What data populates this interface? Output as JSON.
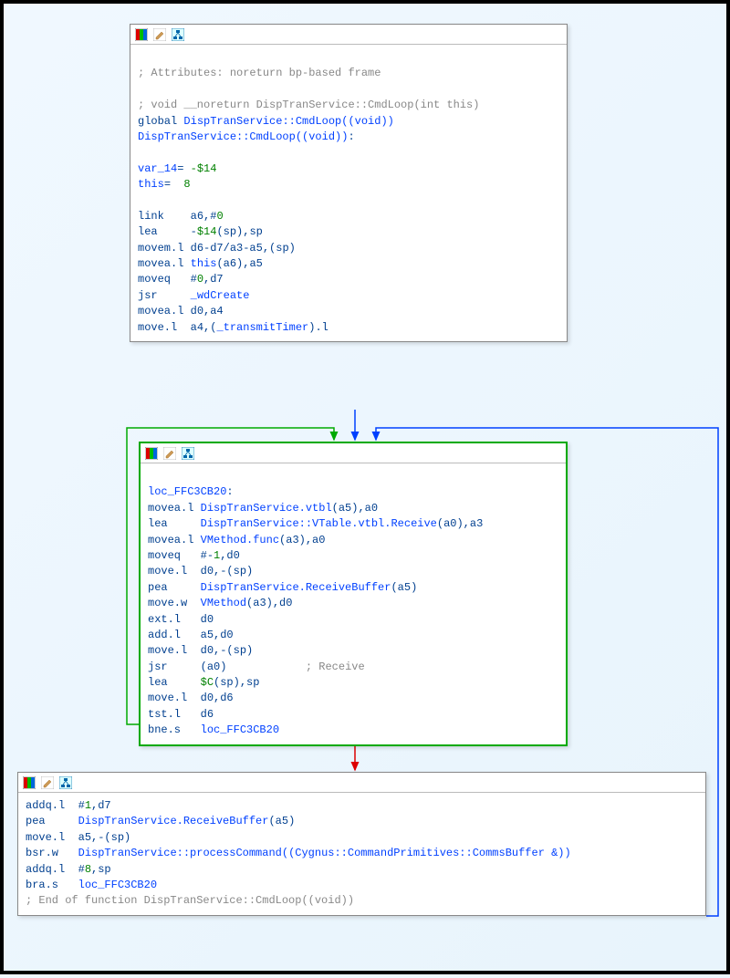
{
  "node1": {
    "comment1": "; Attributes: noreturn bp-based frame",
    "comment2": "; void __noreturn DispTranService::CmdLoop(int this)",
    "decl1_a": "global",
    "decl1_b": "DispTranService::CmdLoop((void))",
    "decl2_a": "DispTranService::CmdLoop((void))",
    "decl2_b": ":",
    "var1_name": "var_14",
    "var1_eq": "= ",
    "var1_val": "-$14",
    "var2_name": "this",
    "var2_eq": "=  ",
    "var2_val": "8",
    "i1_op": "link",
    "i1_arg": "a6,#",
    "i1_lit": "0",
    "i2_op": "lea",
    "i2_arg1": "-",
    "i2_lit": "$14",
    "i2_arg2": "(sp),sp",
    "i3_op": "movem.l",
    "i3_arg": "d6-d7/a3-a5,(sp)",
    "i4_op": "movea.l",
    "i4_ref": "this",
    "i4_arg": "(a6),a5",
    "i5_op": "moveq",
    "i5_arg": "#",
    "i5_lit": "0",
    "i5_arg2": ",d7",
    "i6_op": "jsr",
    "i6_ref": "_wdCreate",
    "i7_op": "movea.l",
    "i7_arg": "d0,a4",
    "i8_op": "move.l",
    "i8_arg1": "a4,(",
    "i8_ref": "_transmitTimer",
    "i8_arg2": ").l"
  },
  "node2": {
    "label": "loc_FFC3CB20",
    "label_colon": ":",
    "i1_op": "movea.l",
    "i1_ref": "DispTranService.vtbl",
    "i1_arg": "(a5),a0",
    "i2_op": "lea",
    "i2_ref": "DispTranService::VTable.vtbl.Receive",
    "i2_arg": "(a0),a3",
    "i3_op": "movea.l",
    "i3_ref": "VMethod.func",
    "i3_arg": "(a3),a0",
    "i4_op": "moveq",
    "i4_arg": "#-",
    "i4_lit": "1",
    "i4_arg2": ",d0",
    "i5_op": "move.l",
    "i5_arg": "d0,-(sp)",
    "i6_op": "pea",
    "i6_ref": "DispTranService.ReceiveBuffer",
    "i6_arg": "(a5)",
    "i7_op": "move.w",
    "i7_ref": "VMethod",
    "i7_arg": "(a3),d0",
    "i8_op": "ext.l",
    "i8_arg": "d0",
    "i9_op": "add.l",
    "i9_arg": "a5,d0",
    "i10_op": "move.l",
    "i10_arg": "d0,-(sp)",
    "i11_op": "jsr",
    "i11_arg": "(a0)",
    "i11_cmt": "; Receive",
    "i12_op": "lea",
    "i12_lit": "$C",
    "i12_arg": "(sp),sp",
    "i13_op": "move.l",
    "i13_arg": "d0,d6",
    "i14_op": "tst.l",
    "i14_arg": "d6",
    "i15_op": "bne.s",
    "i15_ref": "loc_FFC3CB20"
  },
  "node3": {
    "i1_op": "addq.l",
    "i1_arg": "#",
    "i1_lit": "1",
    "i1_arg2": ",d7",
    "i2_op": "pea",
    "i2_ref": "DispTranService.ReceiveBuffer",
    "i2_arg": "(a5)",
    "i3_op": "move.l",
    "i3_arg": "a5,-(sp)",
    "i4_op": "bsr.w",
    "i4_ref": "DispTranService::processCommand((Cygnus::CommandPrimitives::CommsBuffer &))",
    "i5_op": "addq.l",
    "i5_arg": "#",
    "i5_lit": "8",
    "i5_arg2": ",sp",
    "i6_op": "bra.s",
    "i6_ref": "loc_FFC3CB20",
    "end_cmt": "; End of function DispTranService::CmdLoop((void))"
  }
}
